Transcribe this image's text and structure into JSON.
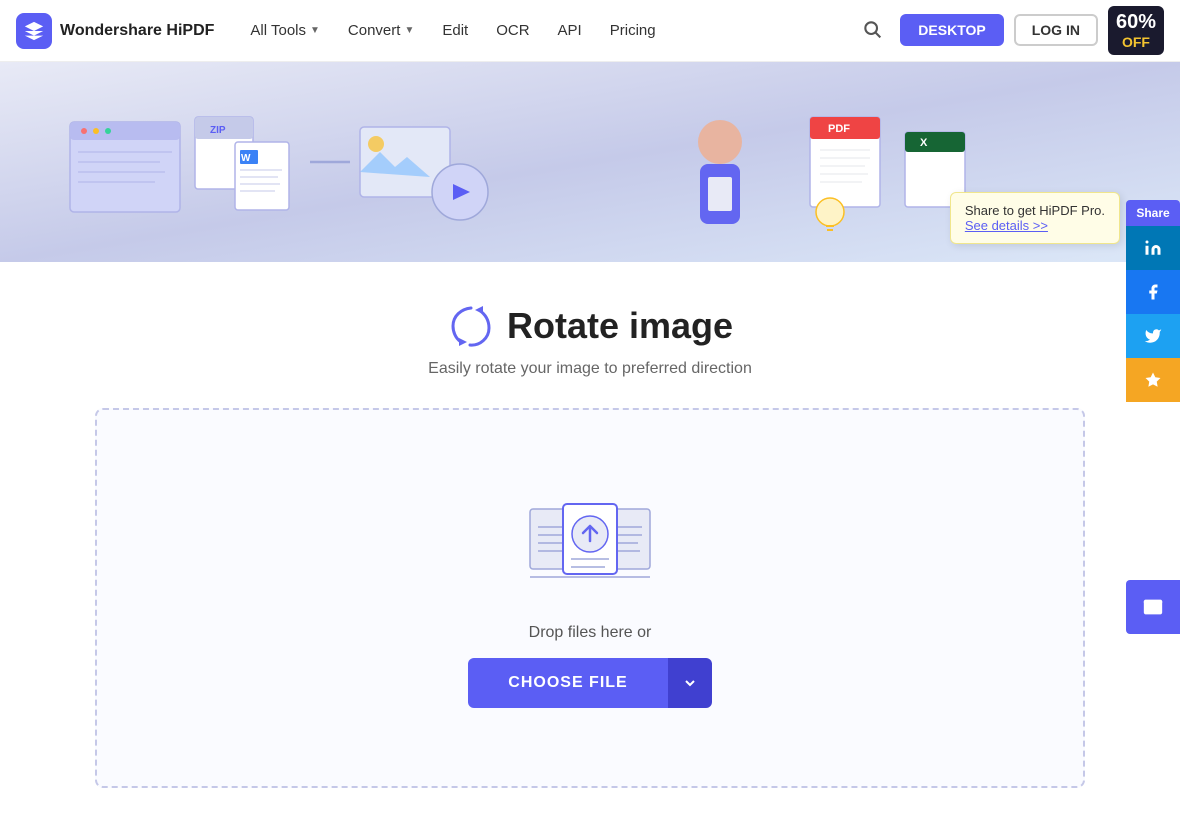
{
  "brand": {
    "name": "Wondershare HiPDF",
    "logo_bg": "#5b5ef4"
  },
  "navbar": {
    "all_tools": "All Tools",
    "convert": "Convert",
    "edit": "Edit",
    "ocr": "OCR",
    "api": "API",
    "pricing": "Pricing",
    "desktop_btn": "DESKTOP",
    "login_btn": "LOG IN",
    "promo_percent": "60%",
    "promo_off": "OFF"
  },
  "tooltip": {
    "line1": "Share to get HiPDF Pro.",
    "link": "See details >>"
  },
  "share": {
    "label": "Share"
  },
  "page": {
    "title": "Rotate image",
    "subtitle": "Easily rotate your image to preferred direction",
    "drop_text": "Drop files here or",
    "choose_file": "CHOOSE FILE"
  }
}
